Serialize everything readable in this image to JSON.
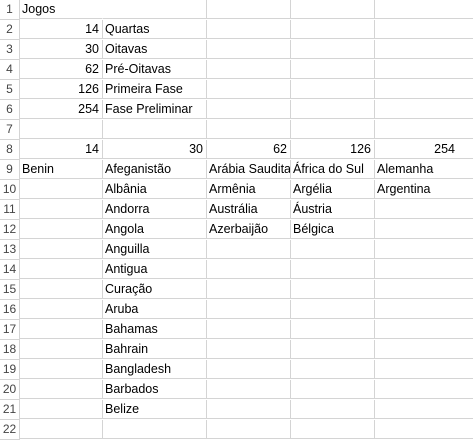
{
  "row_numbers": [
    "1",
    "2",
    "3",
    "4",
    "5",
    "6",
    "7",
    "8",
    "9",
    "10",
    "11",
    "12",
    "13",
    "14",
    "15",
    "16",
    "17",
    "18",
    "19",
    "20",
    "21",
    "22"
  ],
  "cells": {
    "r1_a": "Jogos",
    "r2_a": "14",
    "r2_b": "Quartas",
    "r3_a": "30",
    "r3_b": "Oitavas",
    "r4_a": "62",
    "r4_b": "Pré-Oitavas",
    "r5_a": "126",
    "r5_b": "Primeira Fase",
    "r6_a": "254",
    "r6_b": "Fase Preliminar",
    "r8_a": "14",
    "r8_b": "30",
    "r8_c": "62",
    "r8_d": "126",
    "r8_e": "254",
    "r9_a": "Benin",
    "r9_b": "Afeganistão",
    "r9_c": "Arábia Saudita",
    "r9_d": "África do Sul",
    "r9_e": "Alemanha",
    "r10_b": "Albânia",
    "r10_c": "Armênia",
    "r10_d": "Argélia",
    "r10_e": "Argentina",
    "r11_b": "Andorra",
    "r11_c": "Austrália",
    "r11_d": "Áustria",
    "r12_b": "Angola",
    "r12_c": "Azerbaijão",
    "r12_d": "Bélgica",
    "r13_b": "Anguilla",
    "r14_b": "Antigua",
    "r15_b": "Curação",
    "r16_b": "Aruba",
    "r17_b": "Bahamas",
    "r18_b": "Bahrain",
    "r19_b": "Bangladesh",
    "r20_b": "Barbados",
    "r21_b": "Belize"
  }
}
